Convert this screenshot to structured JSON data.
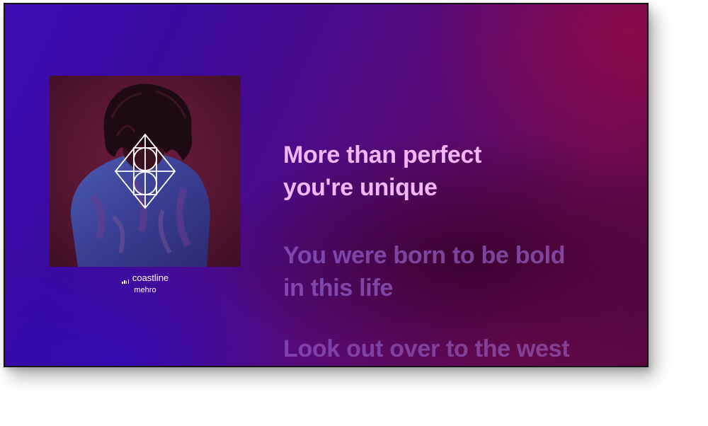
{
  "now_playing": {
    "track_title": "coastline",
    "artist": "mehro",
    "artwork_icon": "album-artwork"
  },
  "lyrics": [
    {
      "lines": [
        "More than perfect",
        "you're unique"
      ],
      "state": "current"
    },
    {
      "lines": [
        "You were born to be bold",
        "in this life"
      ],
      "state": "upcoming"
    },
    {
      "lines": [
        "Look out over to the west"
      ],
      "state": "upcoming"
    }
  ],
  "colors": {
    "current_lyric": "#f2b6f4",
    "upcoming_lyric": "#a06edc",
    "background_left": "#3d0bb3",
    "background_right": "#6b0a55"
  }
}
